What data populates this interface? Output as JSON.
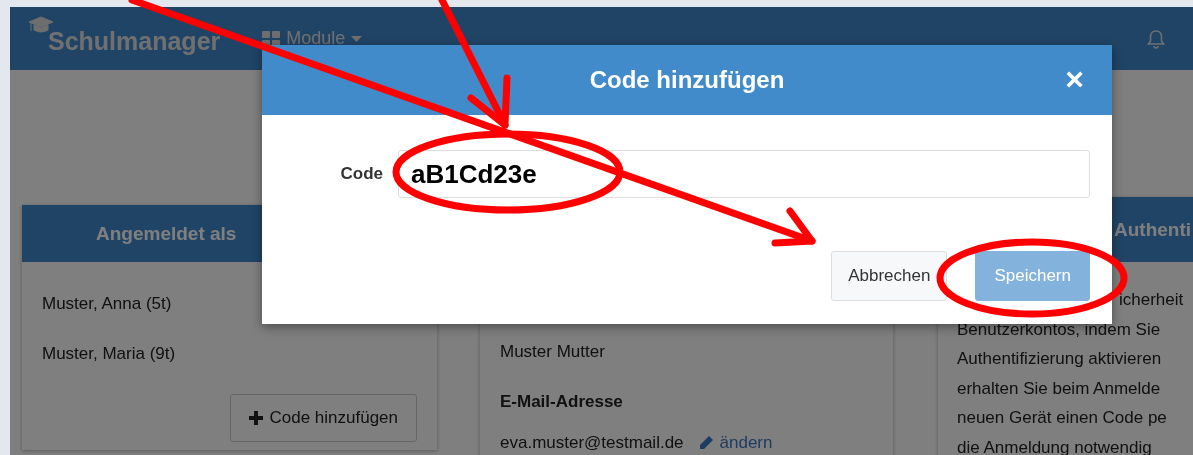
{
  "navbar": {
    "brand": "Schulmanager",
    "menu": "Module"
  },
  "cards": [
    {
      "kind": "children",
      "header": "Angemeldet als",
      "items": [
        "Muster, Anna (5t)",
        "Muster, Maria (9t)"
      ],
      "button": "Code hinzufügen"
    },
    {
      "kind": "account",
      "name": "Muster Mutter",
      "email_label": "E-Mail-Adresse",
      "email": "eva.muster@testmail.de",
      "edit_link": "ändern"
    },
    {
      "kind": "info",
      "header": "Authenti",
      "lines": [
        "icherheit",
        "Benutzerkontos, indem Sie",
        "Authentifizierung aktivieren",
        "erhalten Sie beim Anmelde",
        "neuen Gerät einen Code pe",
        "die Anmeldung notwendig"
      ]
    }
  ],
  "modal": {
    "title": "Code hinzufügen",
    "close": "×",
    "field_label": "Code",
    "field_value": "aB1Cd23e",
    "buttons": [
      {
        "kind": "cancel",
        "label": "Abbrechen",
        "disabled": false
      },
      {
        "kind": "primary",
        "label": "Speichern",
        "disabled": true
      }
    ]
  }
}
